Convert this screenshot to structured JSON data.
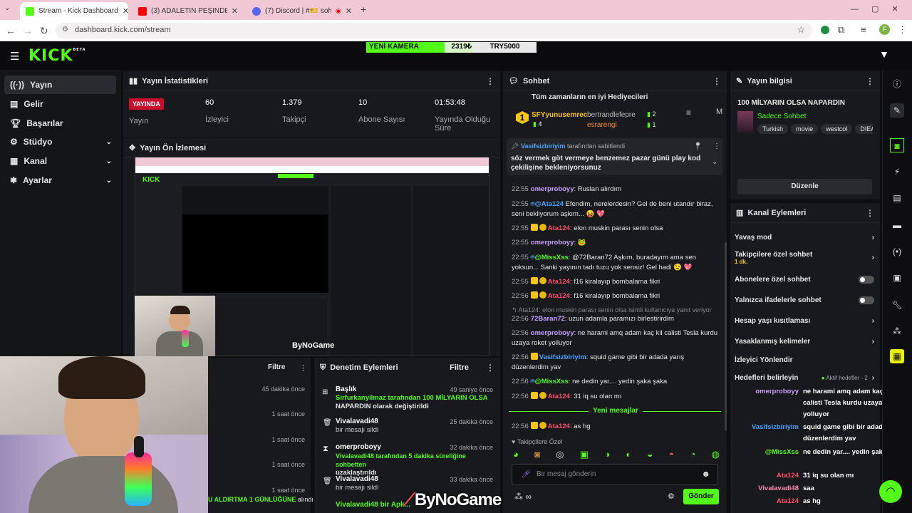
{
  "browser": {
    "tabs": [
      {
        "title": "Stream - Kick Dashboard",
        "color": "#53fc18"
      },
      {
        "title": "(3) ADALETİN PEŞİNDEKİ DEDE...",
        "color": "#ff0000"
      },
      {
        "title": "(7) Discord | #🎫 sohbet |",
        "color": "#5865f2"
      }
    ],
    "url": "dashboard.kick.com/stream",
    "profile_initial": "F"
  },
  "kick": {
    "logo": "KICK",
    "logo_sup": "BETA",
    "donation": {
      "label": "YENİ KAMERA",
      "current": "2319₺",
      "target": "TRY5000",
      "progress_percent": 46
    }
  },
  "sidebar": {
    "items": [
      {
        "label": "Yayın",
        "icon": "broadcast-icon",
        "active": true
      },
      {
        "label": "Gelir",
        "icon": "wallet-icon"
      },
      {
        "label": "Başarılar",
        "icon": "trophy-icon"
      },
      {
        "label": "Stüdyo",
        "icon": "gear-icon",
        "chevron": true
      },
      {
        "label": "Kanal",
        "icon": "grid-icon",
        "chevron": true
      },
      {
        "label": "Ayarlar",
        "icon": "cog-icon",
        "chevron": true
      }
    ]
  },
  "stats": {
    "title": "Yayın İstatistikleri",
    "status": "YAYINDA",
    "status_label": "Yayın",
    "items": [
      {
        "value": "60",
        "label": "İzleyici"
      },
      {
        "value": "1.379",
        "label": "Takipçi"
      },
      {
        "value": "10",
        "label": "Abone Sayısı"
      },
      {
        "value": "01:53:48",
        "label": "Yayında Olduğu Süre"
      }
    ]
  },
  "preview": {
    "title": "Yayın Ön İzlemesi",
    "watermark": "ByNoGame"
  },
  "chat": {
    "title": "Sohbet",
    "top_gifters_title": "Tüm zamanların en iyi Hediyecileri",
    "gifters": [
      {
        "name": "SFYyunusemrec",
        "count": "4"
      },
      {
        "name": "bertrandlefepre",
        "count": "2"
      },
      {
        "name": "esrarengi",
        "count": "1"
      }
    ],
    "pinned_by": "Vasifsizbiriyim",
    "pinned_suffix": "tarafından sabitlendi",
    "pinned_text": "söz vermek göt vermeye benzemez pazar günü play kod çekilişine bekleniyorsunuz",
    "messages": [
      {
        "time": "22:55",
        "user": "omerproboyy",
        "text": "Ruslan alırdım"
      },
      {
        "time": "22:55",
        "user": "@Ata124",
        "text": "Efendim, nerelerdesin? Gel de beni utandır biraz, seni bekliyorum aşkım... 😝 💖"
      },
      {
        "time": "22:55",
        "user": "Ata124",
        "text": "elon muskin parası senin olsa"
      },
      {
        "time": "22:55",
        "user": "omerproboyy",
        "text": "🐸"
      },
      {
        "time": "22:55",
        "user": "@MissXss",
        "text": "@72Baran72 Aşkım, buradayım ama sen yoksun... Sanki yayının tadı tuzu yok sensiz! Gel hadi 😉 💖"
      },
      {
        "time": "22:55",
        "user": "Ata124",
        "text": "f16 kiralayıp bombalama fikri"
      },
      {
        "time": "22:56",
        "user": "Ata124",
        "text": "f16 kiralayıp bombalama fikri"
      },
      {
        "time": "",
        "user": "",
        "text": "↰ Ata124: elon muskin parası senin olsa isimli kullanıcıya yanıt veriyor"
      },
      {
        "time": "22:56",
        "user": "72Baran72",
        "text": "uzun adamla paramızı birlestirirdim"
      },
      {
        "time": "22:56",
        "user": "omerproboyy",
        "text": "ne harami amq adam kaç kil calisti Tesla kurdu uzaya roket yolluyor"
      },
      {
        "time": "22:56",
        "user": "Vasifsizbiriyim",
        "text": "squid game gibi bir adada yarış düzenlerdim yav"
      },
      {
        "time": "22:56",
        "user": "@MissXss",
        "text": "ne dedin yar.... yedin şaka şaka"
      },
      {
        "time": "22:56",
        "user": "Ata124",
        "text": "31 iq su olan mı"
      },
      {
        "time": "22:56",
        "user": "Ata124",
        "text": "as hg"
      }
    ],
    "new_messages": "Yeni mesajlar",
    "followers_only": "Takipçilere Özel",
    "input_placeholder": "Bir mesaj gönderin",
    "send_label": "Gönder"
  },
  "info": {
    "title": "Yayın bilgisi",
    "stream_title": "100 MİLYARIN OLSA NAPARDIN",
    "category": "Sadece Sohbet",
    "tags": [
      "Turkish",
      "movie",
      "westcol",
      "DIEALI"
    ],
    "edit_label": "Düzenle"
  },
  "actions": {
    "title": "Kanal Eylemleri",
    "items": [
      {
        "label": "Yavaş mod",
        "type": "chevron"
      },
      {
        "label": "Takipçilere özel sohbet",
        "sub": "1 dk.",
        "type": "chevron"
      },
      {
        "label": "Abonelere özel sohbet",
        "type": "toggle"
      },
      {
        "label": "Yalnızca ifadelerle sohbet",
        "type": "toggle"
      },
      {
        "label": "Hesap yaşı kısıtlaması",
        "type": "chevron"
      },
      {
        "label": "Yasaklanmış kelimeler",
        "type": "chevron"
      },
      {
        "label": "İzleyici Yönlendir",
        "type": "none"
      },
      {
        "label": "Hedefleri belirleyin",
        "sub": "Aktif hedefler - 2",
        "type": "chevron"
      }
    ]
  },
  "overlay_chat": [
    {
      "name": "omerproboyy",
      "color": "#c9a0ff",
      "text": "ne harami amq adam kaç kil calisti Tesla kurdu uzaya roket yolluyor"
    },
    {
      "name": "Vasifsizbiriyim",
      "color": "#4aa3ff",
      "text": "squid game gibi bir adada yarış düzenlerdim yav"
    },
    {
      "name": "@MissXss",
      "color": "#53fc18",
      "text": "ne dedin yar.... yedin şaka şaka"
    },
    {
      "name": "Ata124",
      "color": "#ff4d6d",
      "text": "31 iq su olan mı"
    },
    {
      "name": "Vivalavadi48",
      "color": "#ff8fb0",
      "text": "saa"
    },
    {
      "name": "Ata124",
      "color": "#ff4d6d",
      "text": "as hg"
    }
  ],
  "filter_panel": {
    "filter_label": "Filtre",
    "times": [
      "45 dakika önce",
      "1 saat önce",
      "1 saat önce",
      "1 saat önce",
      "1 saat önce"
    ],
    "footer_text": "U ALDIRTMA 1 GÜNLÜĞÜNE",
    "footer_suffix": "alındı"
  },
  "mod_panel": {
    "title": "Denetim Eylemleri",
    "filter_label": "Filtre",
    "items": [
      {
        "head": "Başlık",
        "time": "49 saniye önce",
        "line1": "Sirfurkanyilmaz tarafından 100 MİLYARIN OLSA",
        "line2": "NAPARDIN olarak değiştirildi"
      },
      {
        "head": "Vivalavadi48",
        "time": "25 dakika önce",
        "line1": "bir mesajı sildi",
        "line2": ""
      },
      {
        "head": "omerproboyy",
        "time": "32 dakika önce",
        "line1": "Vivalavadi48 tarafından 5 dakika süreliğine sohbetten",
        "line2": "uzaklaştırıldı"
      },
      {
        "head": "Vivalavadi48",
        "time": "33 dakika önce",
        "line1": "bir mesajı sildi",
        "line2": ""
      },
      {
        "head": "Vivalavadi48 bir Apk...",
        "time": "",
        "line1": "",
        "line2": ""
      }
    ]
  },
  "watermark": "ByNoGame"
}
